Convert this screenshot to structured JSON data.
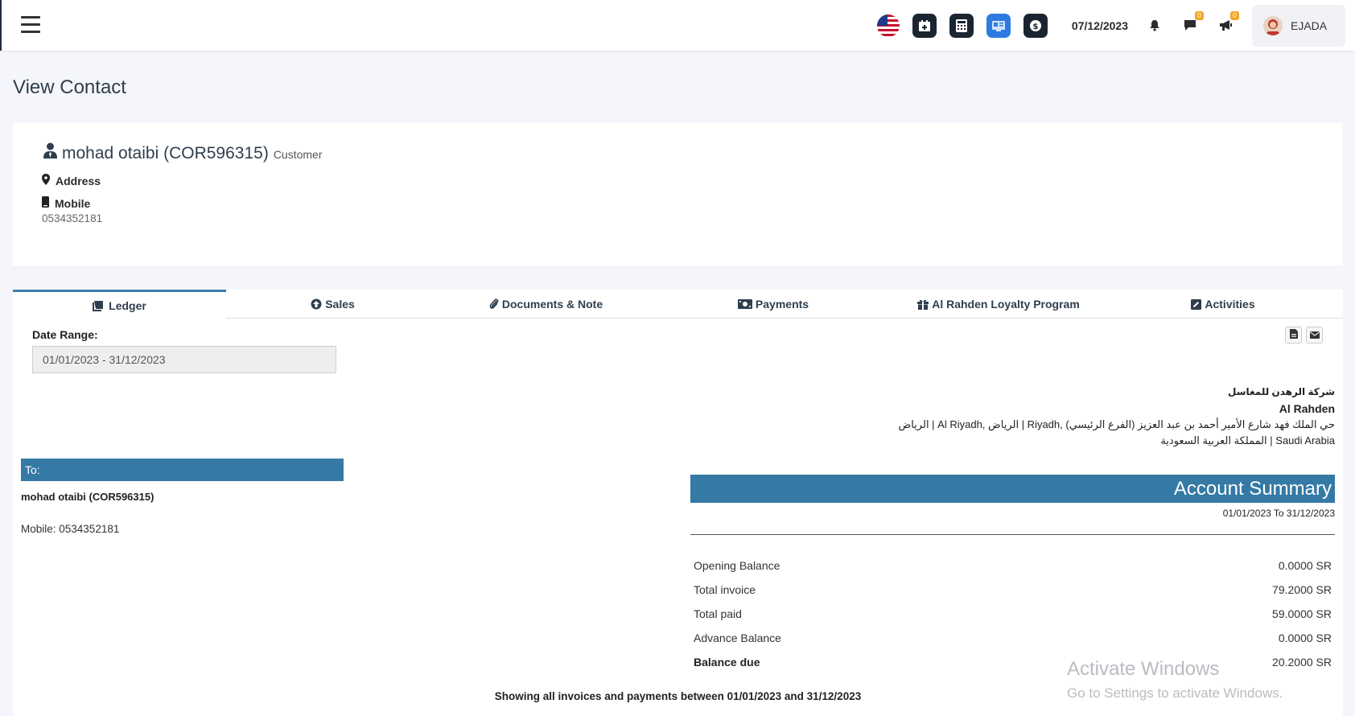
{
  "topbar": {
    "date": "07/12/2023",
    "messages_badge": "0",
    "announcements_badge": "0",
    "user_name": "EJADA",
    "icons": [
      "menu-icon",
      "us-flag-icon",
      "calendar-plus-icon",
      "calculator-icon",
      "pos-icon",
      "cash-icon",
      "bell-icon",
      "comment-icon",
      "bullhorn-icon"
    ]
  },
  "page_title": "View Contact",
  "contact": {
    "name": "mohad otaibi (COR596315)",
    "type": "Customer",
    "address_label": "Address",
    "mobile_label": "Mobile",
    "mobile": "0534352181"
  },
  "tabs": [
    {
      "label": "Ledger",
      "icon": "ledger-icon",
      "active": true
    },
    {
      "label": "Sales",
      "icon": "arrow-circle-up-icon",
      "active": false
    },
    {
      "label": "Documents & Note",
      "icon": "paperclip-icon",
      "active": false
    },
    {
      "label": "Payments",
      "icon": "money-icon",
      "active": false
    },
    {
      "label": "Al Rahden Loyalty Program",
      "icon": "gift-icon",
      "active": false
    },
    {
      "label": "Activities",
      "icon": "edit-icon",
      "active": false
    }
  ],
  "ledger": {
    "date_range_label": "Date Range:",
    "date_range_value": "01/01/2023 - 31/12/2023",
    "company": {
      "arabic_name": "شركة الرهدن للمغاسل",
      "english_name": "Al Rahden",
      "address": "الرياض | Al Riyadh, الرياض | Riyadh, حي الملك فهد شارع الأمير أحمد بن عبد العزيز (الفرع الرئيسي)",
      "country": "المملكة العربية السعودية | Saudi Arabia"
    },
    "to_label": "To:",
    "to_name": "mohad otaibi (COR596315)",
    "to_mobile": "Mobile: 0534352181",
    "summary": {
      "title": "Account Summary",
      "range": "01/01/2023 To 31/12/2023",
      "rows": [
        {
          "label": "Opening Balance",
          "value": "0.0000 SR"
        },
        {
          "label": "Total invoice",
          "value": "79.2000 SR"
        },
        {
          "label": "Total paid",
          "value": "59.0000 SR"
        },
        {
          "label": "Advance Balance",
          "value": "0.0000 SR"
        },
        {
          "label": "Balance due",
          "value": "20.2000 SR"
        }
      ]
    },
    "showing_text": "Showing all invoices and payments between 01/01/2023 and 31/12/2023"
  },
  "watermark": {
    "line1": "Activate Windows",
    "line2": "Go to Settings to activate Windows."
  },
  "colors": {
    "accent": "#3579a5",
    "navbar_dark_button": "#1b2532",
    "badge": "#f4a524"
  }
}
